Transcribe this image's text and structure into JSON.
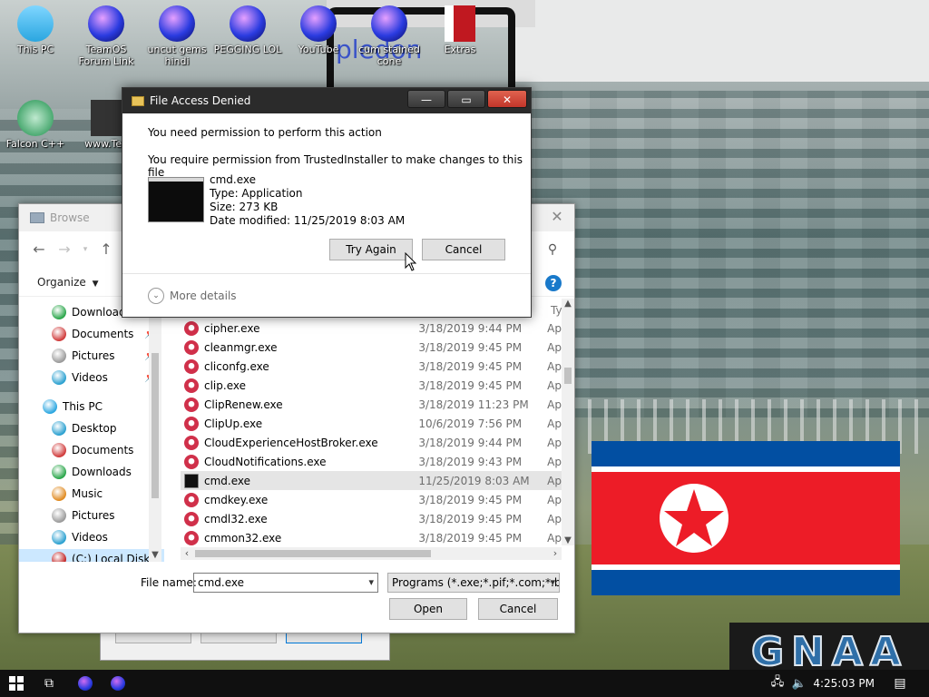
{
  "desktop": {
    "icons": [
      {
        "label": "This PC",
        "icon": "this-pc-icon",
        "color": "#2aa6e0"
      },
      {
        "label": "TeamOS Forum Link",
        "icon": "orb-icon",
        "color": "#2a3be0"
      },
      {
        "label": "uncut gems hindi",
        "icon": "orb-icon",
        "color": "#2a3be0"
      },
      {
        "label": "PEGGING LOL",
        "icon": "orb-icon",
        "color": "#2a3be0"
      },
      {
        "label": "YouTube",
        "icon": "orb-icon",
        "color": "#2a3be0"
      },
      {
        "label": "cum stained cone",
        "icon": "orb-icon",
        "color": "#2a3be0"
      },
      {
        "label": "Extras",
        "icon": "archive-icon",
        "color": "#c01820"
      },
      {
        "label": "Falcon C++",
        "icon": "recycle-icon",
        "color": "#1a8f4a"
      },
      {
        "label": "www.Tea",
        "icon": "document-icon",
        "color": "#333333"
      }
    ],
    "wallpaper_text": "GNAA",
    "overlay_text": "pledon"
  },
  "denied_dialog": {
    "title": "File Access Denied",
    "line1": "You need permission to perform this action",
    "line2": "You require permission from TrustedInstaller to make changes to this file",
    "file_name": "cmd.exe",
    "file_type": "Type: Application",
    "file_size": "Size: 273 KB",
    "file_modified": "Date modified: 11/25/2019 8:03 AM",
    "try_again": "Try Again",
    "cancel": "Cancel",
    "more_details": "More details"
  },
  "browse_dialog": {
    "title": "Browse",
    "organize": "Organize",
    "column_type": "Ty",
    "nav_items": [
      {
        "label": "Download",
        "icon": "downloads-icon",
        "pinned": true,
        "indent": 1
      },
      {
        "label": "Documents",
        "icon": "documents-icon",
        "pinned": true,
        "indent": 1
      },
      {
        "label": "Pictures",
        "icon": "pictures-icon",
        "pinned": true,
        "indent": 1
      },
      {
        "label": "Videos",
        "icon": "videos-icon",
        "pinned": true,
        "indent": 1
      },
      {
        "label": "This PC",
        "icon": "this-pc-icon",
        "pinned": false,
        "indent": 0
      },
      {
        "label": "Desktop",
        "icon": "desktop-icon",
        "pinned": false,
        "indent": 1
      },
      {
        "label": "Documents",
        "icon": "documents-icon",
        "pinned": false,
        "indent": 1
      },
      {
        "label": "Downloads",
        "icon": "downloads-icon",
        "pinned": false,
        "indent": 1
      },
      {
        "label": "Music",
        "icon": "music-icon",
        "pinned": false,
        "indent": 1
      },
      {
        "label": "Pictures",
        "icon": "pictures-icon",
        "pinned": false,
        "indent": 1
      },
      {
        "label": "Videos",
        "icon": "videos-icon",
        "pinned": false,
        "indent": 1
      },
      {
        "label": "(C:) Local Disk",
        "icon": "local-disk-icon",
        "pinned": false,
        "indent": 1
      }
    ],
    "files": [
      {
        "name": "cipher.exe",
        "date": "3/18/2019 9:44 PM",
        "type": "Ap",
        "icon": "exe-icon",
        "selected": false
      },
      {
        "name": "cleanmgr.exe",
        "date": "3/18/2019 9:45 PM",
        "type": "Ap",
        "icon": "exe-icon",
        "selected": false
      },
      {
        "name": "cliconfg.exe",
        "date": "3/18/2019 9:45 PM",
        "type": "Ap",
        "icon": "exe-icon",
        "selected": false
      },
      {
        "name": "clip.exe",
        "date": "3/18/2019 9:45 PM",
        "type": "Ap",
        "icon": "exe-icon",
        "selected": false
      },
      {
        "name": "ClipRenew.exe",
        "date": "3/18/2019 11:23 PM",
        "type": "Ap",
        "icon": "exe-icon",
        "selected": false
      },
      {
        "name": "ClipUp.exe",
        "date": "10/6/2019 7:56 PM",
        "type": "Ap",
        "icon": "exe-icon",
        "selected": false
      },
      {
        "name": "CloudExperienceHostBroker.exe",
        "date": "3/18/2019 9:44 PM",
        "type": "Ap",
        "icon": "exe-icon",
        "selected": false
      },
      {
        "name": "CloudNotifications.exe",
        "date": "3/18/2019 9:43 PM",
        "type": "Ap",
        "icon": "exe-icon",
        "selected": false
      },
      {
        "name": "cmd.exe",
        "date": "11/25/2019 8:03 AM",
        "type": "Ap",
        "icon": "cmd-icon",
        "selected": true
      },
      {
        "name": "cmdkey.exe",
        "date": "3/18/2019 9:45 PM",
        "type": "Ap",
        "icon": "exe-icon",
        "selected": false
      },
      {
        "name": "cmdl32.exe",
        "date": "3/18/2019 9:45 PM",
        "type": "Ap",
        "icon": "exe-icon",
        "selected": false
      },
      {
        "name": "cmmon32.exe",
        "date": "3/18/2019 9:45 PM",
        "type": "Ap",
        "icon": "exe-icon",
        "selected": false
      }
    ],
    "file_name_label": "File name:",
    "file_name_value": "cmd.exe",
    "filter_value": "Programs (*.exe;*.pif;*.com;*.ba",
    "open": "Open",
    "cancel": "Cancel"
  },
  "taskbar": {
    "clock": "4:25:03 PM",
    "items": [
      "start-icon",
      "task-view-icon",
      "orb-icon",
      "orb-icon"
    ]
  },
  "colors": {
    "titlebar_dark": "#2b2b2b",
    "close_red": "#c2352a",
    "selection": "#cce8ff",
    "flag_blue": "#024fa2",
    "flag_red": "#ed1c27"
  }
}
